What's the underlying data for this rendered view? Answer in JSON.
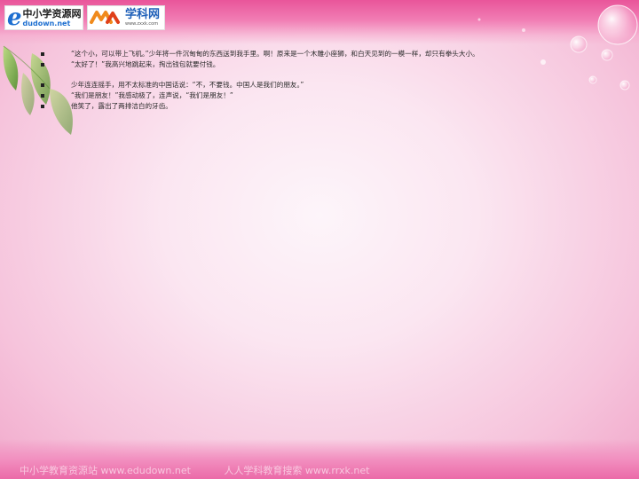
{
  "logos": {
    "left": {
      "mark": "e",
      "name": "中小学资源网",
      "domain": "dudown.net"
    },
    "right": {
      "name": "学科网",
      "domain": "www.zxxk.com"
    }
  },
  "paragraphs": [
    {
      "lines": [
        "“这个小，可以带上飞机。”少年将一件沉甸甸的东西送到我手里。啊！原来是一个木雕小座狮，和白天见到的一模一样，却只有拳头大小。",
        "“太好了！”我高兴地跳起来，掏出钱包就要付钱。"
      ]
    },
    {
      "lines": [
        "少年连连摇手，用不太标准的中国话说：“不，不要钱。中国人是我们的朋友。”",
        "“我们是朋友！”我感动极了，连声说，“我们是朋友！”",
        "他笑了，露出了两排洁白的牙齿。"
      ]
    }
  ],
  "footer": {
    "left": "中小学教育资源站 www.edudown.net",
    "right": "人人学科教育搜索 www.rrxk.net"
  },
  "icons": [
    "green-leaf-icon",
    "bubble-icon"
  ],
  "colors": {
    "band": "#e9559a",
    "background": "#fbe6f1",
    "leaf": "#7cb342",
    "logo_blue": "#1e6fd0",
    "logo_orange": "#f08a1c"
  }
}
